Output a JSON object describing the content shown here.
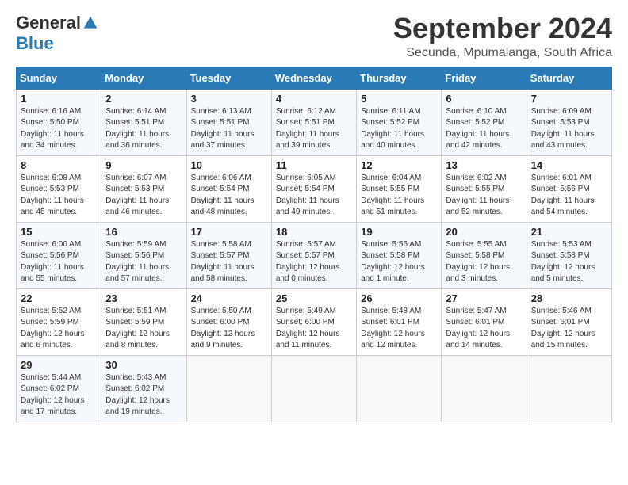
{
  "header": {
    "logo_general": "General",
    "logo_blue": "Blue",
    "month": "September 2024",
    "location": "Secunda, Mpumalanga, South Africa"
  },
  "weekdays": [
    "Sunday",
    "Monday",
    "Tuesday",
    "Wednesday",
    "Thursday",
    "Friday",
    "Saturday"
  ],
  "weeks": [
    [
      {
        "day": "1",
        "sunrise": "6:16 AM",
        "sunset": "5:50 PM",
        "daylight": "11 hours and 34 minutes."
      },
      {
        "day": "2",
        "sunrise": "6:14 AM",
        "sunset": "5:51 PM",
        "daylight": "11 hours and 36 minutes."
      },
      {
        "day": "3",
        "sunrise": "6:13 AM",
        "sunset": "5:51 PM",
        "daylight": "11 hours and 37 minutes."
      },
      {
        "day": "4",
        "sunrise": "6:12 AM",
        "sunset": "5:51 PM",
        "daylight": "11 hours and 39 minutes."
      },
      {
        "day": "5",
        "sunrise": "6:11 AM",
        "sunset": "5:52 PM",
        "daylight": "11 hours and 40 minutes."
      },
      {
        "day": "6",
        "sunrise": "6:10 AM",
        "sunset": "5:52 PM",
        "daylight": "11 hours and 42 minutes."
      },
      {
        "day": "7",
        "sunrise": "6:09 AM",
        "sunset": "5:53 PM",
        "daylight": "11 hours and 43 minutes."
      }
    ],
    [
      {
        "day": "8",
        "sunrise": "6:08 AM",
        "sunset": "5:53 PM",
        "daylight": "11 hours and 45 minutes."
      },
      {
        "day": "9",
        "sunrise": "6:07 AM",
        "sunset": "5:53 PM",
        "daylight": "11 hours and 46 minutes."
      },
      {
        "day": "10",
        "sunrise": "6:06 AM",
        "sunset": "5:54 PM",
        "daylight": "11 hours and 48 minutes."
      },
      {
        "day": "11",
        "sunrise": "6:05 AM",
        "sunset": "5:54 PM",
        "daylight": "11 hours and 49 minutes."
      },
      {
        "day": "12",
        "sunrise": "6:04 AM",
        "sunset": "5:55 PM",
        "daylight": "11 hours and 51 minutes."
      },
      {
        "day": "13",
        "sunrise": "6:02 AM",
        "sunset": "5:55 PM",
        "daylight": "11 hours and 52 minutes."
      },
      {
        "day": "14",
        "sunrise": "6:01 AM",
        "sunset": "5:56 PM",
        "daylight": "11 hours and 54 minutes."
      }
    ],
    [
      {
        "day": "15",
        "sunrise": "6:00 AM",
        "sunset": "5:56 PM",
        "daylight": "11 hours and 55 minutes."
      },
      {
        "day": "16",
        "sunrise": "5:59 AM",
        "sunset": "5:56 PM",
        "daylight": "11 hours and 57 minutes."
      },
      {
        "day": "17",
        "sunrise": "5:58 AM",
        "sunset": "5:57 PM",
        "daylight": "11 hours and 58 minutes."
      },
      {
        "day": "18",
        "sunrise": "5:57 AM",
        "sunset": "5:57 PM",
        "daylight": "12 hours and 0 minutes."
      },
      {
        "day": "19",
        "sunrise": "5:56 AM",
        "sunset": "5:58 PM",
        "daylight": "12 hours and 1 minute."
      },
      {
        "day": "20",
        "sunrise": "5:55 AM",
        "sunset": "5:58 PM",
        "daylight": "12 hours and 3 minutes."
      },
      {
        "day": "21",
        "sunrise": "5:53 AM",
        "sunset": "5:58 PM",
        "daylight": "12 hours and 5 minutes."
      }
    ],
    [
      {
        "day": "22",
        "sunrise": "5:52 AM",
        "sunset": "5:59 PM",
        "daylight": "12 hours and 6 minutes."
      },
      {
        "day": "23",
        "sunrise": "5:51 AM",
        "sunset": "5:59 PM",
        "daylight": "12 hours and 8 minutes."
      },
      {
        "day": "24",
        "sunrise": "5:50 AM",
        "sunset": "6:00 PM",
        "daylight": "12 hours and 9 minutes."
      },
      {
        "day": "25",
        "sunrise": "5:49 AM",
        "sunset": "6:00 PM",
        "daylight": "12 hours and 11 minutes."
      },
      {
        "day": "26",
        "sunrise": "5:48 AM",
        "sunset": "6:01 PM",
        "daylight": "12 hours and 12 minutes."
      },
      {
        "day": "27",
        "sunrise": "5:47 AM",
        "sunset": "6:01 PM",
        "daylight": "12 hours and 14 minutes."
      },
      {
        "day": "28",
        "sunrise": "5:46 AM",
        "sunset": "6:01 PM",
        "daylight": "12 hours and 15 minutes."
      }
    ],
    [
      {
        "day": "29",
        "sunrise": "5:44 AM",
        "sunset": "6:02 PM",
        "daylight": "12 hours and 17 minutes."
      },
      {
        "day": "30",
        "sunrise": "5:43 AM",
        "sunset": "6:02 PM",
        "daylight": "12 hours and 19 minutes."
      },
      null,
      null,
      null,
      null,
      null
    ]
  ]
}
